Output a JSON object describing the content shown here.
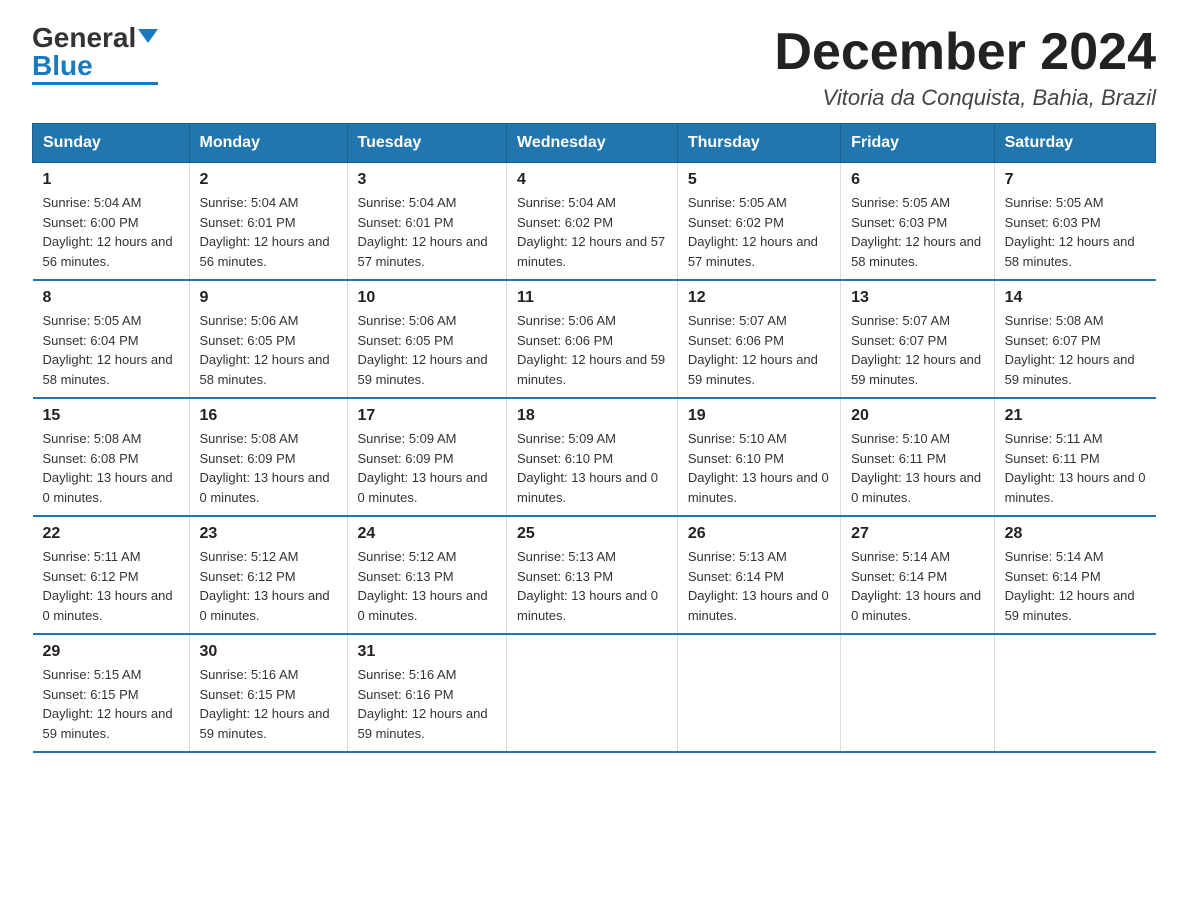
{
  "header": {
    "title": "December 2024",
    "subtitle": "Vitoria da Conquista, Bahia, Brazil",
    "logo_general": "General",
    "logo_blue": "Blue"
  },
  "days_of_week": [
    "Sunday",
    "Monday",
    "Tuesday",
    "Wednesday",
    "Thursday",
    "Friday",
    "Saturday"
  ],
  "weeks": [
    [
      {
        "day": "1",
        "sunrise": "5:04 AM",
        "sunset": "6:00 PM",
        "daylight": "12 hours and 56 minutes."
      },
      {
        "day": "2",
        "sunrise": "5:04 AM",
        "sunset": "6:01 PM",
        "daylight": "12 hours and 56 minutes."
      },
      {
        "day": "3",
        "sunrise": "5:04 AM",
        "sunset": "6:01 PM",
        "daylight": "12 hours and 57 minutes."
      },
      {
        "day": "4",
        "sunrise": "5:04 AM",
        "sunset": "6:02 PM",
        "daylight": "12 hours and 57 minutes."
      },
      {
        "day": "5",
        "sunrise": "5:05 AM",
        "sunset": "6:02 PM",
        "daylight": "12 hours and 57 minutes."
      },
      {
        "day": "6",
        "sunrise": "5:05 AM",
        "sunset": "6:03 PM",
        "daylight": "12 hours and 58 minutes."
      },
      {
        "day": "7",
        "sunrise": "5:05 AM",
        "sunset": "6:03 PM",
        "daylight": "12 hours and 58 minutes."
      }
    ],
    [
      {
        "day": "8",
        "sunrise": "5:05 AM",
        "sunset": "6:04 PM",
        "daylight": "12 hours and 58 minutes."
      },
      {
        "day": "9",
        "sunrise": "5:06 AM",
        "sunset": "6:05 PM",
        "daylight": "12 hours and 58 minutes."
      },
      {
        "day": "10",
        "sunrise": "5:06 AM",
        "sunset": "6:05 PM",
        "daylight": "12 hours and 59 minutes."
      },
      {
        "day": "11",
        "sunrise": "5:06 AM",
        "sunset": "6:06 PM",
        "daylight": "12 hours and 59 minutes."
      },
      {
        "day": "12",
        "sunrise": "5:07 AM",
        "sunset": "6:06 PM",
        "daylight": "12 hours and 59 minutes."
      },
      {
        "day": "13",
        "sunrise": "5:07 AM",
        "sunset": "6:07 PM",
        "daylight": "12 hours and 59 minutes."
      },
      {
        "day": "14",
        "sunrise": "5:08 AM",
        "sunset": "6:07 PM",
        "daylight": "12 hours and 59 minutes."
      }
    ],
    [
      {
        "day": "15",
        "sunrise": "5:08 AM",
        "sunset": "6:08 PM",
        "daylight": "13 hours and 0 minutes."
      },
      {
        "day": "16",
        "sunrise": "5:08 AM",
        "sunset": "6:09 PM",
        "daylight": "13 hours and 0 minutes."
      },
      {
        "day": "17",
        "sunrise": "5:09 AM",
        "sunset": "6:09 PM",
        "daylight": "13 hours and 0 minutes."
      },
      {
        "day": "18",
        "sunrise": "5:09 AM",
        "sunset": "6:10 PM",
        "daylight": "13 hours and 0 minutes."
      },
      {
        "day": "19",
        "sunrise": "5:10 AM",
        "sunset": "6:10 PM",
        "daylight": "13 hours and 0 minutes."
      },
      {
        "day": "20",
        "sunrise": "5:10 AM",
        "sunset": "6:11 PM",
        "daylight": "13 hours and 0 minutes."
      },
      {
        "day": "21",
        "sunrise": "5:11 AM",
        "sunset": "6:11 PM",
        "daylight": "13 hours and 0 minutes."
      }
    ],
    [
      {
        "day": "22",
        "sunrise": "5:11 AM",
        "sunset": "6:12 PM",
        "daylight": "13 hours and 0 minutes."
      },
      {
        "day": "23",
        "sunrise": "5:12 AM",
        "sunset": "6:12 PM",
        "daylight": "13 hours and 0 minutes."
      },
      {
        "day": "24",
        "sunrise": "5:12 AM",
        "sunset": "6:13 PM",
        "daylight": "13 hours and 0 minutes."
      },
      {
        "day": "25",
        "sunrise": "5:13 AM",
        "sunset": "6:13 PM",
        "daylight": "13 hours and 0 minutes."
      },
      {
        "day": "26",
        "sunrise": "5:13 AM",
        "sunset": "6:14 PM",
        "daylight": "13 hours and 0 minutes."
      },
      {
        "day": "27",
        "sunrise": "5:14 AM",
        "sunset": "6:14 PM",
        "daylight": "13 hours and 0 minutes."
      },
      {
        "day": "28",
        "sunrise": "5:14 AM",
        "sunset": "6:14 PM",
        "daylight": "12 hours and 59 minutes."
      }
    ],
    [
      {
        "day": "29",
        "sunrise": "5:15 AM",
        "sunset": "6:15 PM",
        "daylight": "12 hours and 59 minutes."
      },
      {
        "day": "30",
        "sunrise": "5:16 AM",
        "sunset": "6:15 PM",
        "daylight": "12 hours and 59 minutes."
      },
      {
        "day": "31",
        "sunrise": "5:16 AM",
        "sunset": "6:16 PM",
        "daylight": "12 hours and 59 minutes."
      },
      null,
      null,
      null,
      null
    ]
  ]
}
